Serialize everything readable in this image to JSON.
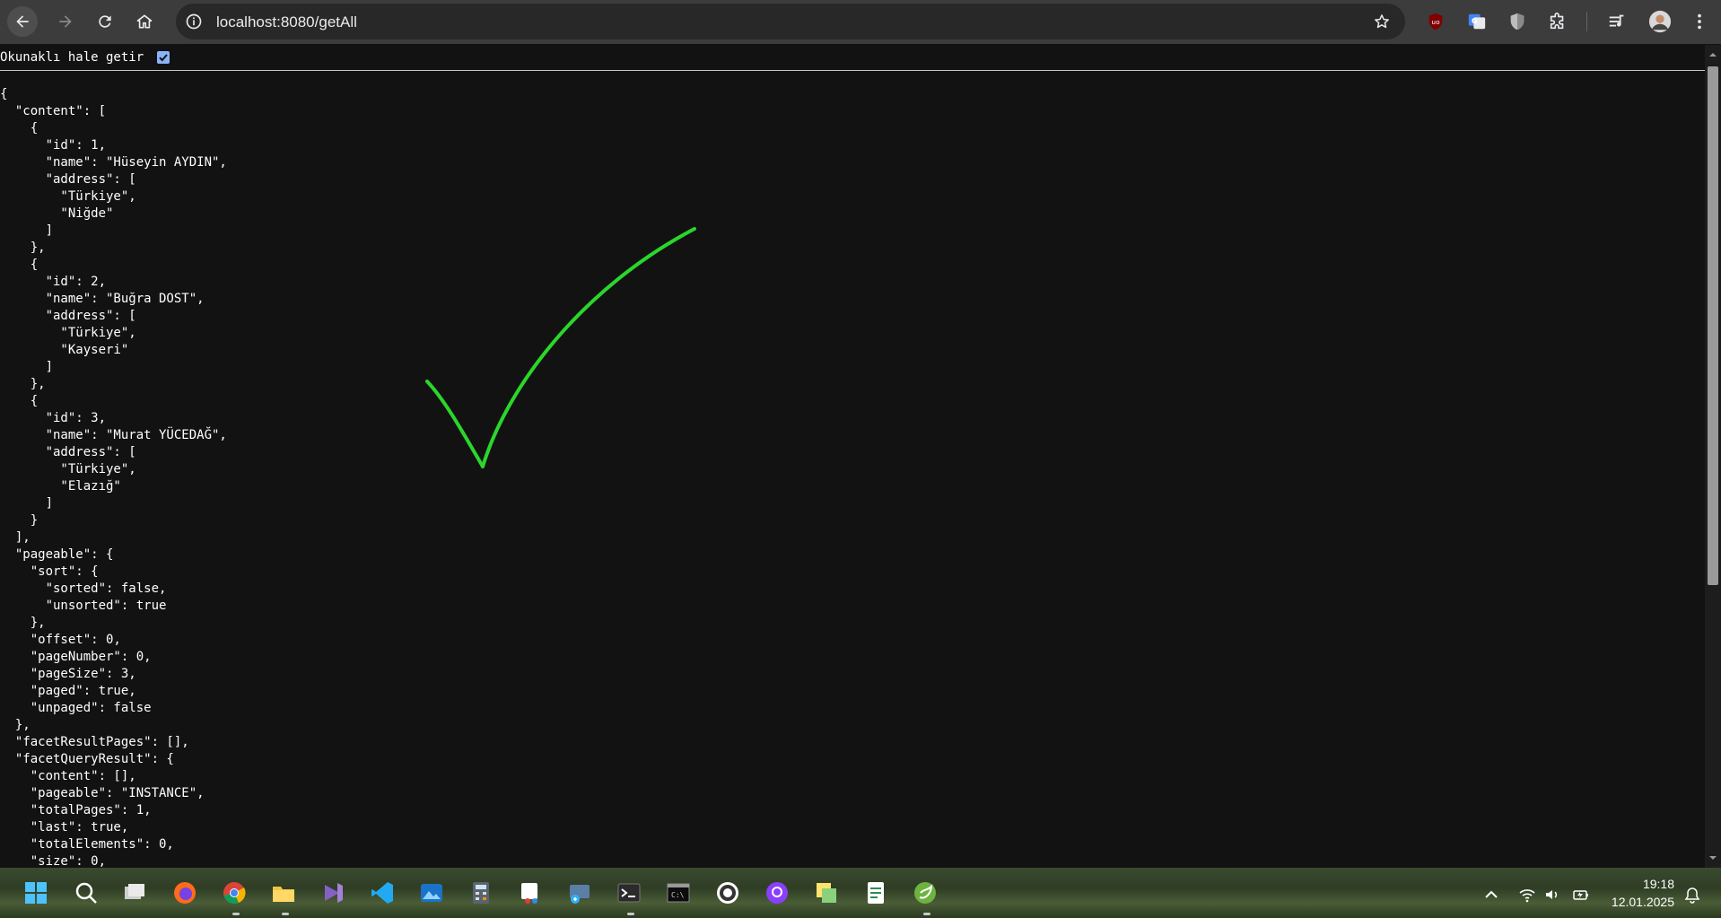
{
  "browser": {
    "url": "localhost:8080/getAll",
    "nav": {
      "back": "back-icon",
      "forward": "forward-icon",
      "reload": "reload-icon",
      "home": "home-icon"
    }
  },
  "viewer": {
    "pretty_print_label": "Okunaklı hale getir",
    "pretty_print_checked": true,
    "lines": [
      "{",
      "  \"content\": [",
      "    {",
      "      \"id\": 1,",
      "      \"name\": \"Hüseyin AYDIN\",",
      "      \"address\": [",
      "        \"Türkiye\",",
      "        \"Niğde\"",
      "      ]",
      "    },",
      "    {",
      "      \"id\": 2,",
      "      \"name\": \"Buğra DOST\",",
      "      \"address\": [",
      "        \"Türkiye\",",
      "        \"Kayseri\"",
      "      ]",
      "    },",
      "    {",
      "      \"id\": 3,",
      "      \"name\": \"Murat YÜCEDAĞ\",",
      "      \"address\": [",
      "        \"Türkiye\",",
      "        \"Elazığ\"",
      "      ]",
      "    }",
      "  ],",
      "  \"pageable\": {",
      "    \"sort\": {",
      "      \"sorted\": false,",
      "      \"unsorted\": true",
      "    },",
      "    \"offset\": 0,",
      "    \"pageNumber\": 0,",
      "    \"pageSize\": 3,",
      "    \"paged\": true,",
      "    \"unpaged\": false",
      "  },",
      "  \"facetResultPages\": [],",
      "  \"facetQueryResult\": {",
      "    \"content\": [],",
      "    \"pageable\": \"INSTANCE\",",
      "    \"totalPages\": 1,",
      "    \"last\": true,",
      "    \"totalElements\": 0,",
      "    \"size\": 0,"
    ]
  },
  "annotation": {
    "color": "#2bd62b"
  },
  "taskbar": {
    "apps": [
      "windows-start-icon",
      "search-icon",
      "task-view-icon",
      "firefox-icon",
      "chrome-icon",
      "file-explorer-icon",
      "visual-studio-icon",
      "vscode-icon",
      "photos-icon",
      "calculator-icon",
      "snipping-tool-icon",
      "remote-desktop-icon",
      "terminal-icon",
      "cmd-icon",
      "postman-icon",
      "github-desktop-icon",
      "sticky-notes-icon",
      "notepad-icon",
      "spring-tools-icon"
    ],
    "time": "19:18",
    "date": "12.01.2025"
  }
}
